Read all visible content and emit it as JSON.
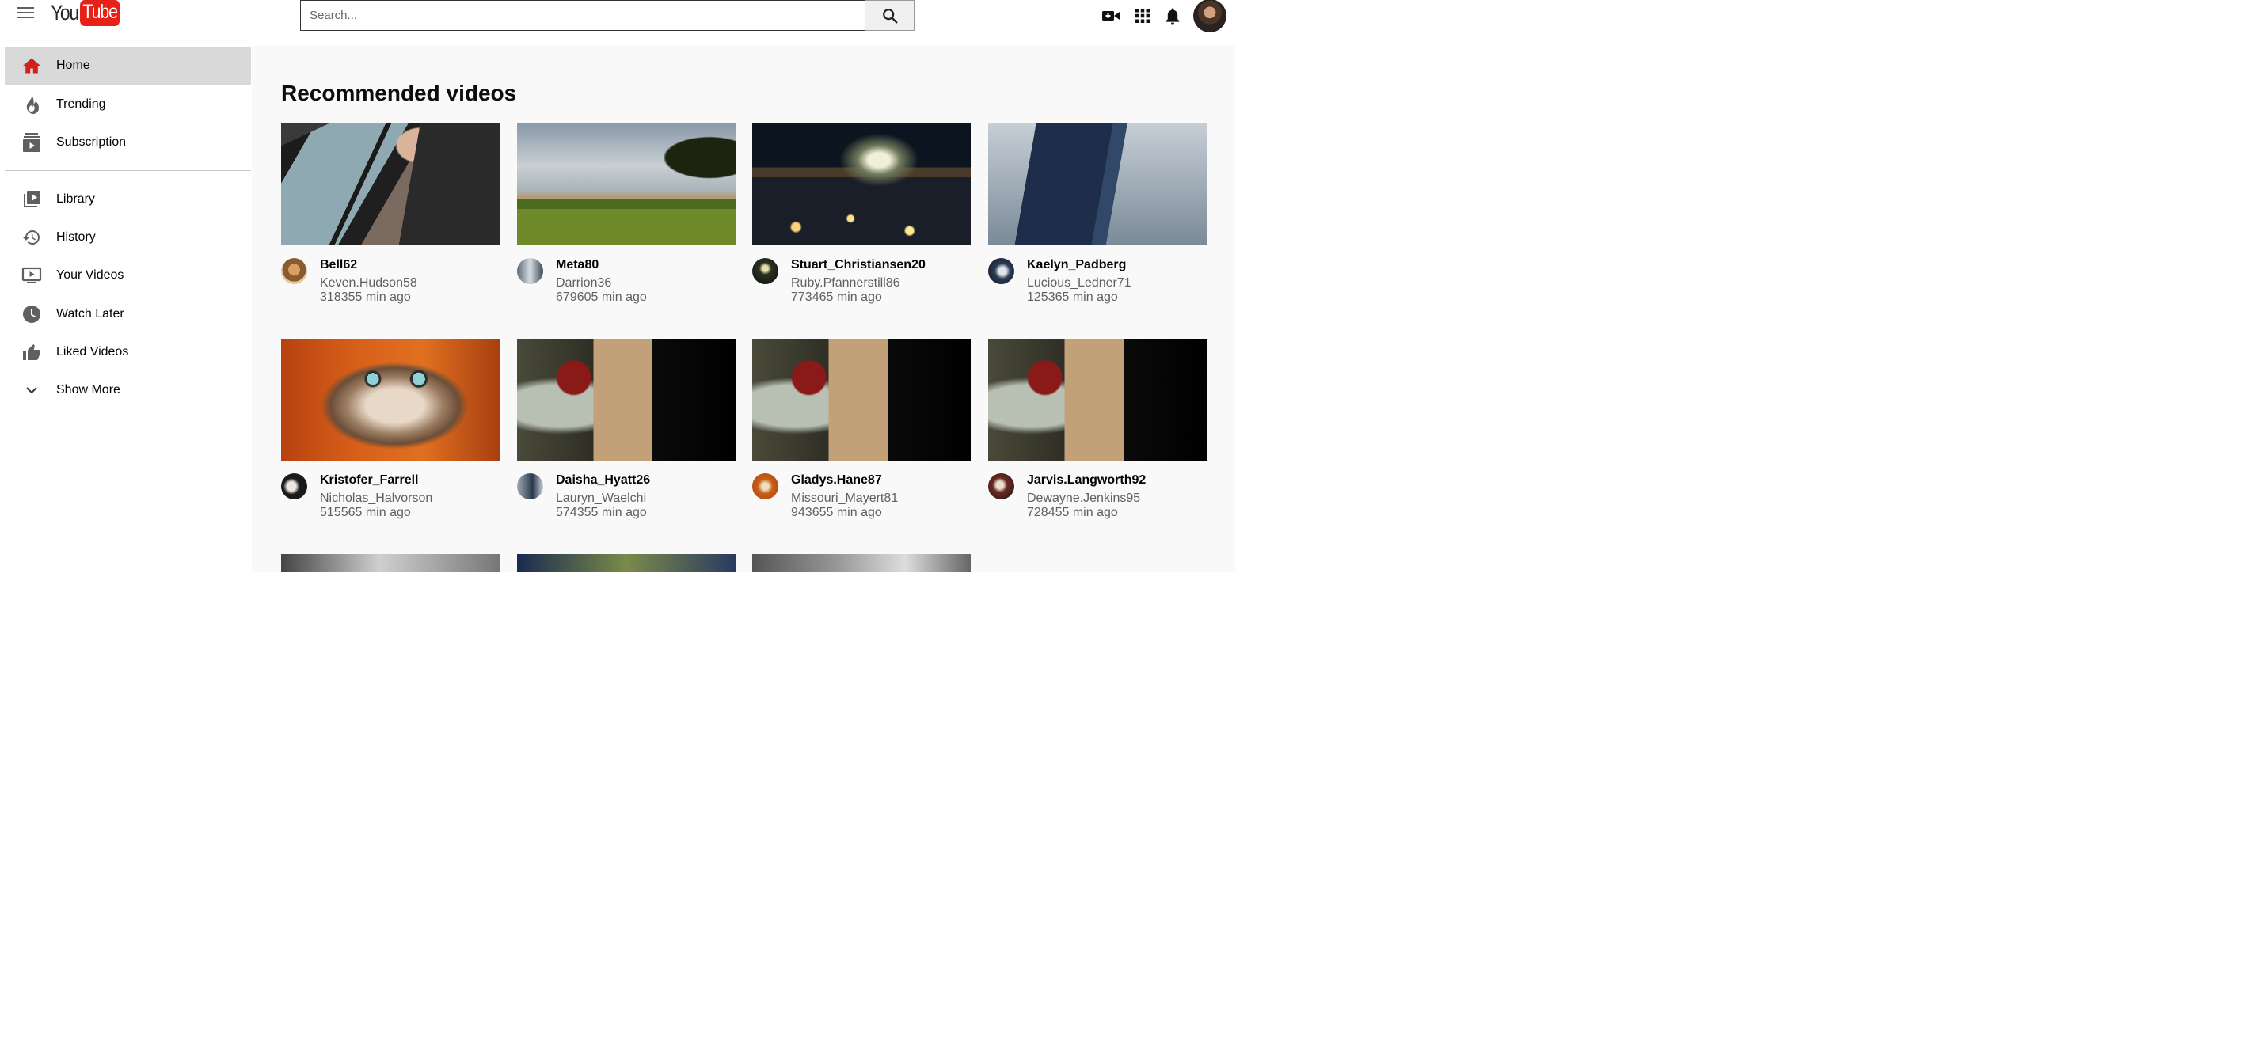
{
  "header": {
    "logo_you": "You",
    "logo_tube": "Tube",
    "search_placeholder": "Search...",
    "icons": [
      "menu-icon",
      "search-icon",
      "video-camera-icon",
      "apps-grid-icon",
      "notifications-bell-icon",
      "user-avatar"
    ]
  },
  "sidebar": {
    "items": [
      {
        "label": "Home",
        "icon": "home-icon",
        "active": true
      },
      {
        "label": "Trending",
        "icon": "fire-icon"
      },
      {
        "label": "Subscription",
        "icon": "subscriptions-icon"
      },
      {
        "label": "Library",
        "icon": "library-icon"
      },
      {
        "label": "History",
        "icon": "history-icon"
      },
      {
        "label": "Your Videos",
        "icon": "your-videos-icon"
      },
      {
        "label": "Watch Later",
        "icon": "clock-icon"
      },
      {
        "label": "Liked Videos",
        "icon": "thumbs-up-icon"
      },
      {
        "label": "Show More",
        "icon": "chevron-down-icon"
      }
    ]
  },
  "main": {
    "title": "Recommended videos",
    "videos": [
      {
        "title": "Bell62",
        "channel": "Keven.Hudson58",
        "time": "318355 min ago"
      },
      {
        "title": "Meta80",
        "channel": "Darrion36",
        "time": "679605 min ago"
      },
      {
        "title": "Stuart_Christiansen20",
        "channel": "Ruby.Pfannerstill86",
        "time": "773465 min ago"
      },
      {
        "title": "Kaelyn_Padberg",
        "channel": "Lucious_Ledner71",
        "time": "125365 min ago"
      },
      {
        "title": "Kristofer_Farrell",
        "channel": "Nicholas_Halvorson",
        "time": "515565 min ago"
      },
      {
        "title": "Daisha_Hyatt26",
        "channel": "Lauryn_Waelchi",
        "time": "574355 min ago"
      },
      {
        "title": "Gladys.Hane87",
        "channel": "Missouri_Mayert81",
        "time": "943655 min ago"
      },
      {
        "title": "Jarvis.Langworth92",
        "channel": "Dewayne.Jenkins95",
        "time": "728455 min ago"
      }
    ]
  },
  "colors": {
    "brand_red": "#e62117",
    "active_nav_bg": "#d9d9d9",
    "main_bg": "#f9f9f9",
    "secondary_text": "#606060"
  }
}
